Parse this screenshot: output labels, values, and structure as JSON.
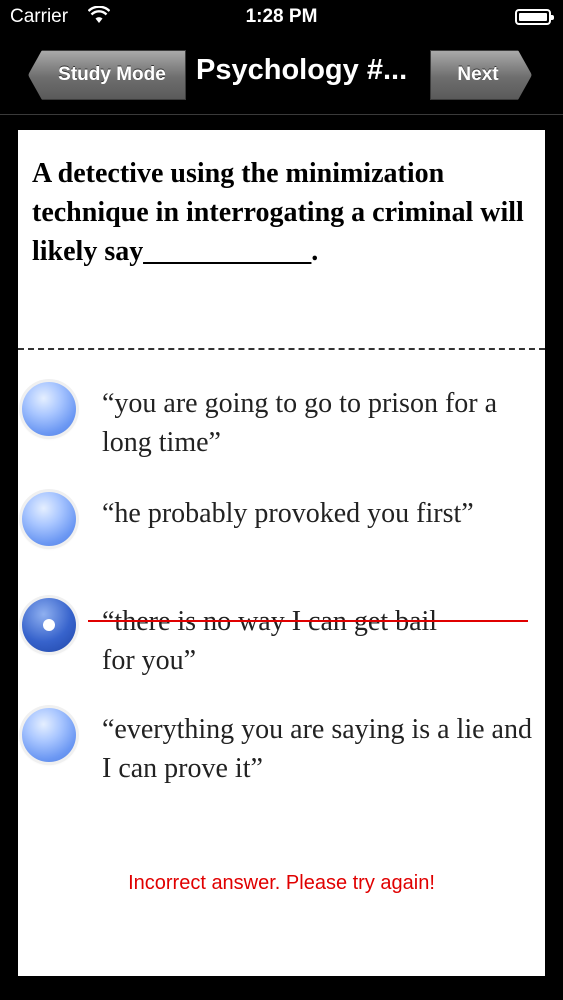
{
  "status_bar": {
    "carrier": "Carrier",
    "time": "1:28 PM"
  },
  "nav": {
    "back_label": "Study Mode",
    "title": "Psychology #...",
    "next_label": "Next"
  },
  "question": {
    "text": "A detective using the minimization technique in interrogating a criminal will likely say____________."
  },
  "options": [
    {
      "text": "“you are going to go to prison for a long time”",
      "selected": false,
      "crossed_out": false
    },
    {
      "text": "“he probably provoked you first”",
      "selected": false,
      "crossed_out": false
    },
    {
      "line1": "“there is no way I can get bail",
      "line2": "for you”",
      "selected": true,
      "crossed_out": true
    },
    {
      "text": "“everything you are saying is a lie and I can prove it”",
      "selected": false,
      "crossed_out": false
    }
  ],
  "feedback": {
    "text": "Incorrect answer. Please try again!",
    "color": "#e00000"
  },
  "colors": {
    "accent_radio": "#6c98f3",
    "error": "#e00000",
    "nav_background": "#000000"
  }
}
